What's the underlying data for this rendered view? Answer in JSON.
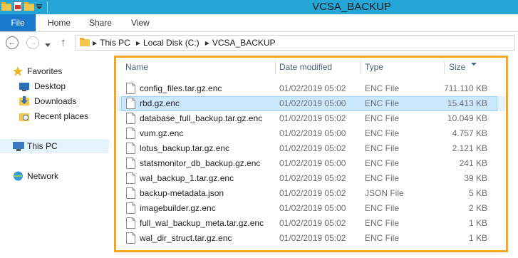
{
  "window": {
    "title": "VCSA_BACKUP"
  },
  "ribbon": {
    "file_label": "File",
    "tabs": [
      "Home",
      "Share",
      "View"
    ]
  },
  "address": {
    "breadcrumbs": [
      "This PC",
      "Local Disk (C:)",
      "VCSA_BACKUP"
    ]
  },
  "sidebar": {
    "items": [
      {
        "label": "Favorites",
        "icon": "star-icon"
      },
      {
        "label": "Desktop",
        "icon": "desktop-icon"
      },
      {
        "label": "Downloads",
        "icon": "downloads-icon"
      },
      {
        "label": "Recent places",
        "icon": "recent-places-icon"
      },
      {
        "label": "This PC",
        "icon": "computer-icon"
      },
      {
        "label": "Network",
        "icon": "network-icon"
      }
    ]
  },
  "columns": {
    "name": "Name",
    "date": "Date modified",
    "type": "Type",
    "size": "Size"
  },
  "files": [
    {
      "name": "config_files.tar.gz.enc",
      "date": "01/02/2019 05:02",
      "type": "ENC File",
      "size": "711.110 KB"
    },
    {
      "name": "rbd.gz.enc",
      "date": "01/02/2019 05:00",
      "type": "ENC File",
      "size": "15.413 KB"
    },
    {
      "name": "database_full_backup.tar.gz.enc",
      "date": "01/02/2019 05:02",
      "type": "ENC File",
      "size": "10.049 KB"
    },
    {
      "name": "vum.gz.enc",
      "date": "01/02/2019 05:00",
      "type": "ENC File",
      "size": "4.757 KB"
    },
    {
      "name": "lotus_backup.tar.gz.enc",
      "date": "01/02/2019 05:02",
      "type": "ENC File",
      "size": "2.121 KB"
    },
    {
      "name": "statsmonitor_db_backup.gz.enc",
      "date": "01/02/2019 05:00",
      "type": "ENC File",
      "size": "241 KB"
    },
    {
      "name": "wal_backup_1.tar.gz.enc",
      "date": "01/02/2019 05:02",
      "type": "ENC File",
      "size": "39 KB"
    },
    {
      "name": "backup-metadata.json",
      "date": "01/02/2019 05:02",
      "type": "JSON File",
      "size": "5 KB"
    },
    {
      "name": "imagebuilder.gz.enc",
      "date": "01/02/2019 05:00",
      "type": "ENC File",
      "size": "2 KB"
    },
    {
      "name": "full_wal_backup_meta.tar.gz.enc",
      "date": "01/02/2019 05:02",
      "type": "ENC File",
      "size": "1 KB"
    },
    {
      "name": "wal_dir_struct.tar.gz.enc",
      "date": "01/02/2019 05:02",
      "type": "ENC File",
      "size": "1 KB"
    }
  ],
  "colors": {
    "titlebar": "#24a7d8",
    "file_tab": "#1979ca",
    "highlight_border": "#f4a721",
    "selection": "#cce8ff"
  }
}
